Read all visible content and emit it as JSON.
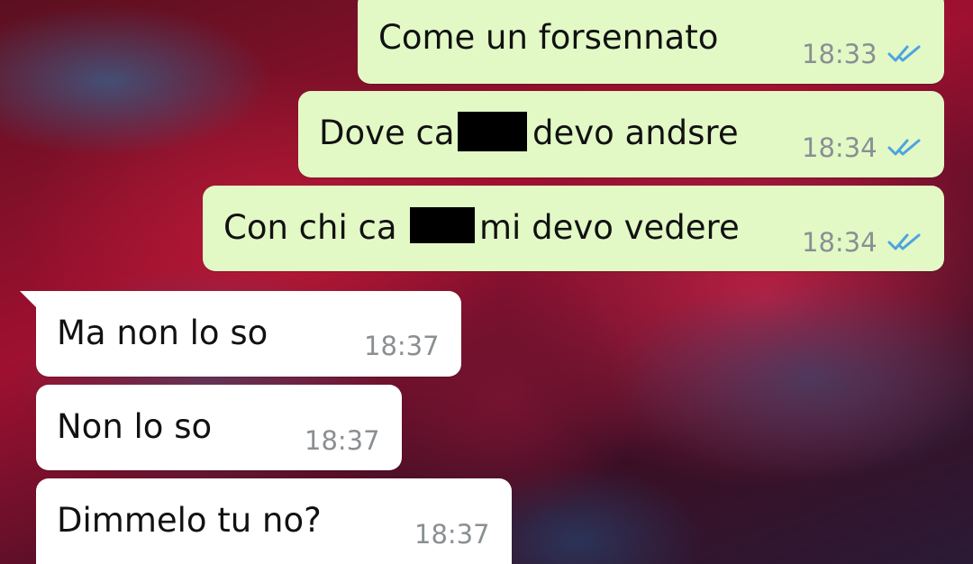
{
  "chat": {
    "messages": [
      {
        "direction": "outgoing",
        "text_pre": "Come un forsennato",
        "text_post": "",
        "time": "18:33",
        "status": "read",
        "redacted": false
      },
      {
        "direction": "outgoing",
        "text_pre": "Dove ca",
        "text_post": "devo andsre",
        "time": "18:34",
        "status": "read",
        "redacted": true
      },
      {
        "direction": "outgoing",
        "text_pre": "Con chi ca",
        "text_post": "mi devo vedere",
        "time": "18:34",
        "status": "read",
        "redacted": true
      },
      {
        "direction": "incoming",
        "text_pre": "Ma non lo so",
        "text_post": "",
        "time": "18:37",
        "redacted": false
      },
      {
        "direction": "incoming",
        "text_pre": "Non lo so",
        "text_post": "",
        "time": "18:37",
        "redacted": false
      },
      {
        "direction": "incoming",
        "text_pre": "Dimmelo tu no?",
        "text_post": "",
        "time": "18:37",
        "redacted": false
      }
    ]
  },
  "colors": {
    "outgoing_bubble": "#e2f9c6",
    "incoming_bubble": "#ffffff",
    "read_ticks": "#4fa3e0",
    "timestamp": "#8a8f93"
  },
  "icons": {
    "read_receipt": "double-check-icon",
    "redaction": "black-bar"
  }
}
